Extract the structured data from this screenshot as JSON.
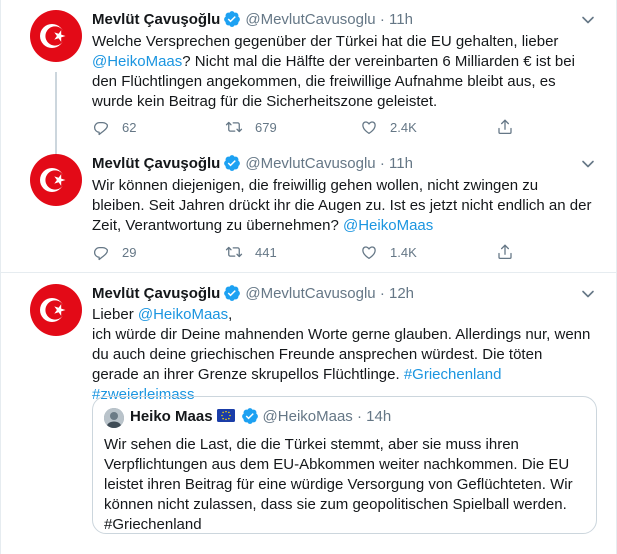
{
  "tweets": [
    {
      "name": "Mevlüt Çavuşoğlu",
      "handle": "@MevlutCavusoglu",
      "separator": "·",
      "time": "11h",
      "text_parts": [
        "Welche Versprechen gegenüber der Türkei hat die EU gehalten, lieber ",
        "@HeikoMaas",
        "? Nicht mal die Hälfte der vereinbarten 6 Milliarden € ist bei den Flüchtlingen angekommen, die freiwillige Aufnahme bleibt aus, es wurde kein Beitrag für die Sicherheitszone geleistet."
      ],
      "replies": "62",
      "retweets": "679",
      "likes": "2.4K"
    },
    {
      "name": "Mevlüt Çavuşoğlu",
      "handle": "@MevlutCavusoglu",
      "separator": "·",
      "time": "11h",
      "text_parts": [
        "Wir können diejenigen, die freiwillig gehen wollen, nicht zwingen zu bleiben. Seit Jahren drückt ihr die Augen zu. Ist es jetzt nicht endlich an der Zeit, Verantwortung zu übernehmen? ",
        "@HeikoMaas"
      ],
      "replies": "29",
      "retweets": "441",
      "likes": "1.4K"
    },
    {
      "name": "Mevlüt Çavuşoğlu",
      "handle": "@MevlutCavusoglu",
      "separator": "·",
      "time": "12h",
      "text_parts": [
        "Lieber ",
        "@HeikoMaas",
        ",",
        "ich würde dir Deine mahnenden Worte gerne glauben. Allerdings nur, wenn du auch deine griechischen Freunde ansprechen würdest. Die töten gerade an ihrer Grenze skrupellos Flüchtlinge. ",
        "#Griechenland",
        " ",
        "#zweierleimass"
      ],
      "quote": {
        "name": "Heiko Maas",
        "handle": "@HeikoMaas",
        "separator": "·",
        "time": "14h",
        "text": "Wir sehen die Last, die die Türkei stemmt, aber sie muss ihren Verpflichtungen aus dem EU-Abkommen weiter nachkommen. Die EU leistet ihren Beitrag für eine würdige Versorgung von Geflüchteten. Wir können nicht zulassen, dass sie zum geopolitischen Spielball werden. #Griechenland"
      }
    }
  ],
  "colors": {
    "link": "#1b95e0",
    "verified": "#1da1f2",
    "flag_red": "#e30a17",
    "muted": "#657786",
    "border": "#e6ecf0"
  },
  "icons": [
    "turkish-flag-avatar",
    "verified-badge-icon",
    "chevron-down-icon",
    "reply-icon",
    "retweet-icon",
    "like-icon",
    "share-icon",
    "eu-flag-icon"
  ]
}
